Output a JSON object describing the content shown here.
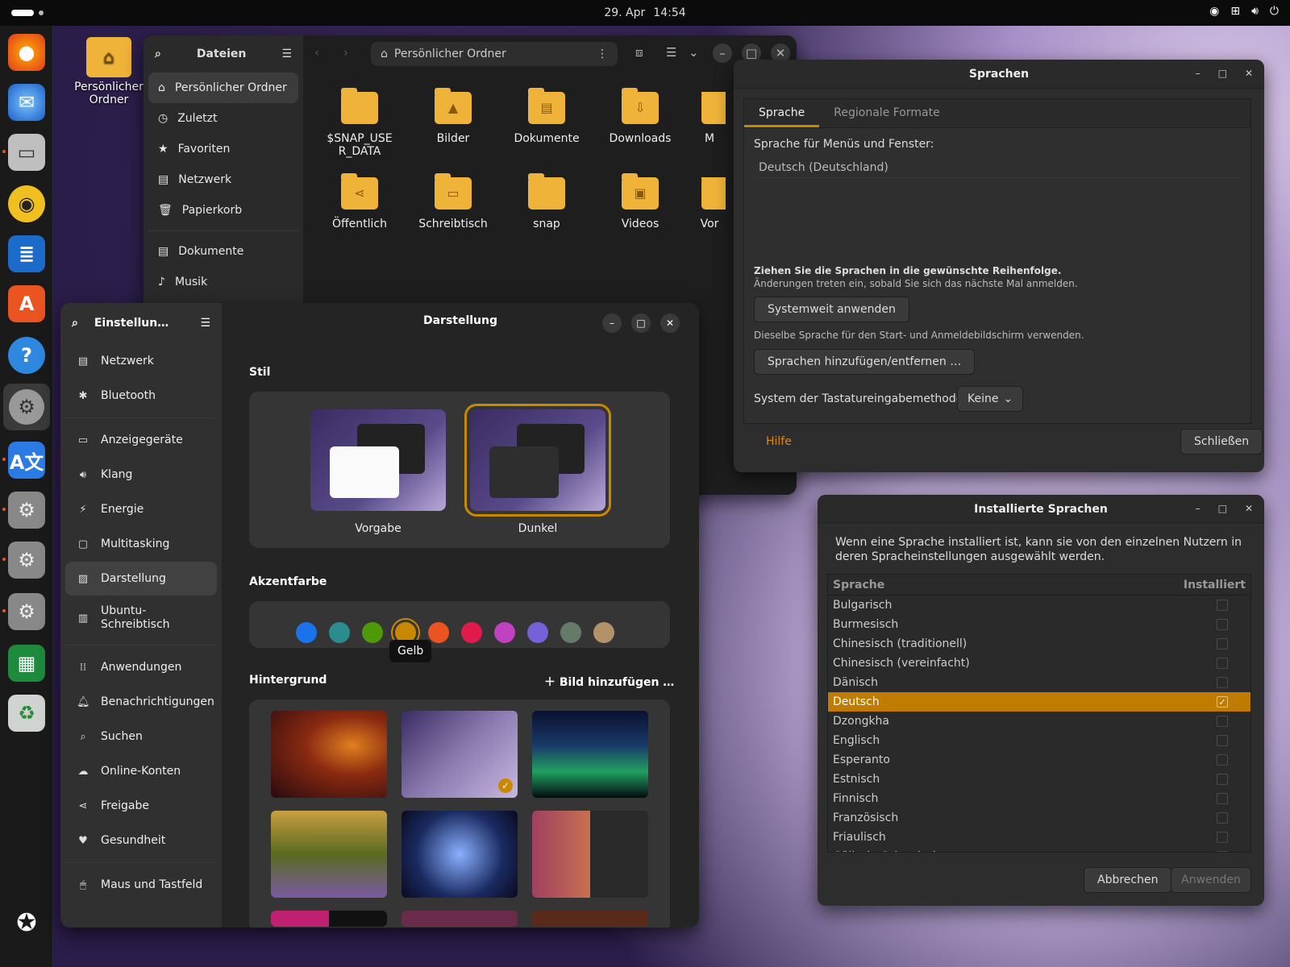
{
  "topbar": {
    "date": "29. Apr",
    "time": "14:54"
  },
  "desktop": {
    "home_label": "Persönlicher Ordner"
  },
  "files": {
    "title": "Dateien",
    "path": "Persönlicher Ordner",
    "sidebar": [
      "Persönlicher Ordner",
      "Zuletzt",
      "Favoriten",
      "Netzwerk",
      "Papierkorb"
    ],
    "sidebar2": [
      "Dokumente",
      "Musik"
    ],
    "folders": [
      "$SNAP_USER_DATA",
      "Bilder",
      "Dokumente",
      "Downloads",
      "M",
      "Öffentlich",
      "Schreibtisch",
      "snap",
      "Videos",
      "Vor"
    ]
  },
  "settings": {
    "sidebar_title": "Einstellun…",
    "page_title": "Darstellung",
    "items": [
      "Netzwerk",
      "Bluetooth",
      "Anzeigegeräte",
      "Klang",
      "Energie",
      "Multitasking",
      "Darstellung",
      "Ubuntu-Schreibtisch",
      "Anwendungen",
      "Benachrichtigungen",
      "Suchen",
      "Online-Konten",
      "Freigabe",
      "Gesundheit",
      "Maus und Tastfeld"
    ],
    "stil_label": "Stil",
    "style_default": "Vorgabe",
    "style_dark": "Dunkel",
    "accent_label": "Akzentfarbe",
    "accent_tooltip": "Gelb",
    "accent_colors": [
      "#1a73e8",
      "#2a8c8c",
      "#4e9a06",
      "#c88800",
      "#e95420",
      "#e01b4c",
      "#c042c0",
      "#7761d8",
      "#657b69",
      "#b39169"
    ],
    "bg_label": "Hintergrund",
    "add_image": "Bild hinzufügen …"
  },
  "sprachen": {
    "title": "Sprachen",
    "tab1": "Sprache",
    "tab2": "Regionale Formate",
    "menu_label": "Sprache für Menüs und Fenster:",
    "current_lang": "Deutsch (Deutschland)",
    "drag_hint": "Ziehen Sie die Sprachen in die gewünschte Reihenfolge.",
    "change_hint": "Änderungen treten ein, sobald Sie sich das nächste Mal anmelden.",
    "apply_system": "Systemweit anwenden",
    "apply_hint": "Dieselbe Sprache für den Start- und Anmeldebildschirm verwenden.",
    "add_remove": "Sprachen hinzufügen/entfernen …",
    "ime_label": "System der Tastatureingabemethode:",
    "ime_value": "Keine",
    "help": "Hilfe",
    "close": "Schließen"
  },
  "installed": {
    "title": "Installierte Sprachen",
    "info": "Wenn eine Sprache installiert ist, kann sie von den einzelnen Nutzern in deren Spracheinstellungen ausgewählt werden.",
    "col_lang": "Sprache",
    "col_inst": "Installiert",
    "rows": [
      "Bulgarisch",
      "Burmesisch",
      "Chinesisch (traditionell)",
      "Chinesisch (vereinfacht)",
      "Dänisch",
      "Deutsch",
      "Dzongkha",
      "Englisch",
      "Esperanto",
      "Estnisch",
      "Finnisch",
      "Französisch",
      "Friaulisch",
      "Gälisch, Schottisch"
    ],
    "selected": "Deutsch",
    "cancel": "Abbrechen",
    "apply": "Anwenden"
  }
}
